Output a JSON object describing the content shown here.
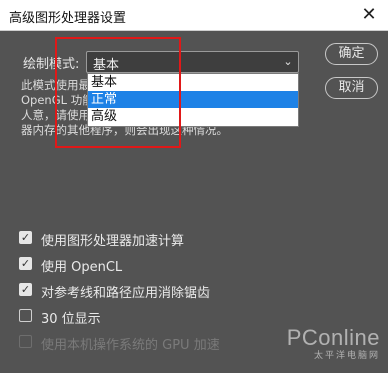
{
  "window": {
    "title": "高级图形处理器设置",
    "close_glyph": "✕"
  },
  "draw_mode": {
    "label": "绘制模式:",
    "selected": "基本",
    "options": [
      "基本",
      "正常",
      "高级"
    ],
    "highlighted": "正常"
  },
  "description": {
    "lines": [
      "此模式使用最",
      "OpenGL 功能",
      "人意，请使用",
      "器内存的其他程序，则会出现这种情况。"
    ]
  },
  "buttons": {
    "ok": "确定",
    "cancel": "取消"
  },
  "options": [
    {
      "label": "使用图形处理器加速计算",
      "checked": true,
      "enabled": true
    },
    {
      "label": "使用 OpenCL",
      "checked": true,
      "enabled": true
    },
    {
      "label": "对参考线和路径应用消除锯齿",
      "checked": true,
      "enabled": true
    },
    {
      "label": "30 位显示",
      "checked": false,
      "enabled": true
    },
    {
      "label": "使用本机操作系统的 GPU 加速",
      "checked": false,
      "enabled": false
    }
  ],
  "watermark": {
    "brand": "PConline",
    "sub": "太平洋电脑网"
  },
  "colors": {
    "accent": "#1e82e6",
    "highlight_box": "#e01818",
    "dialog_bg": "#535353"
  }
}
